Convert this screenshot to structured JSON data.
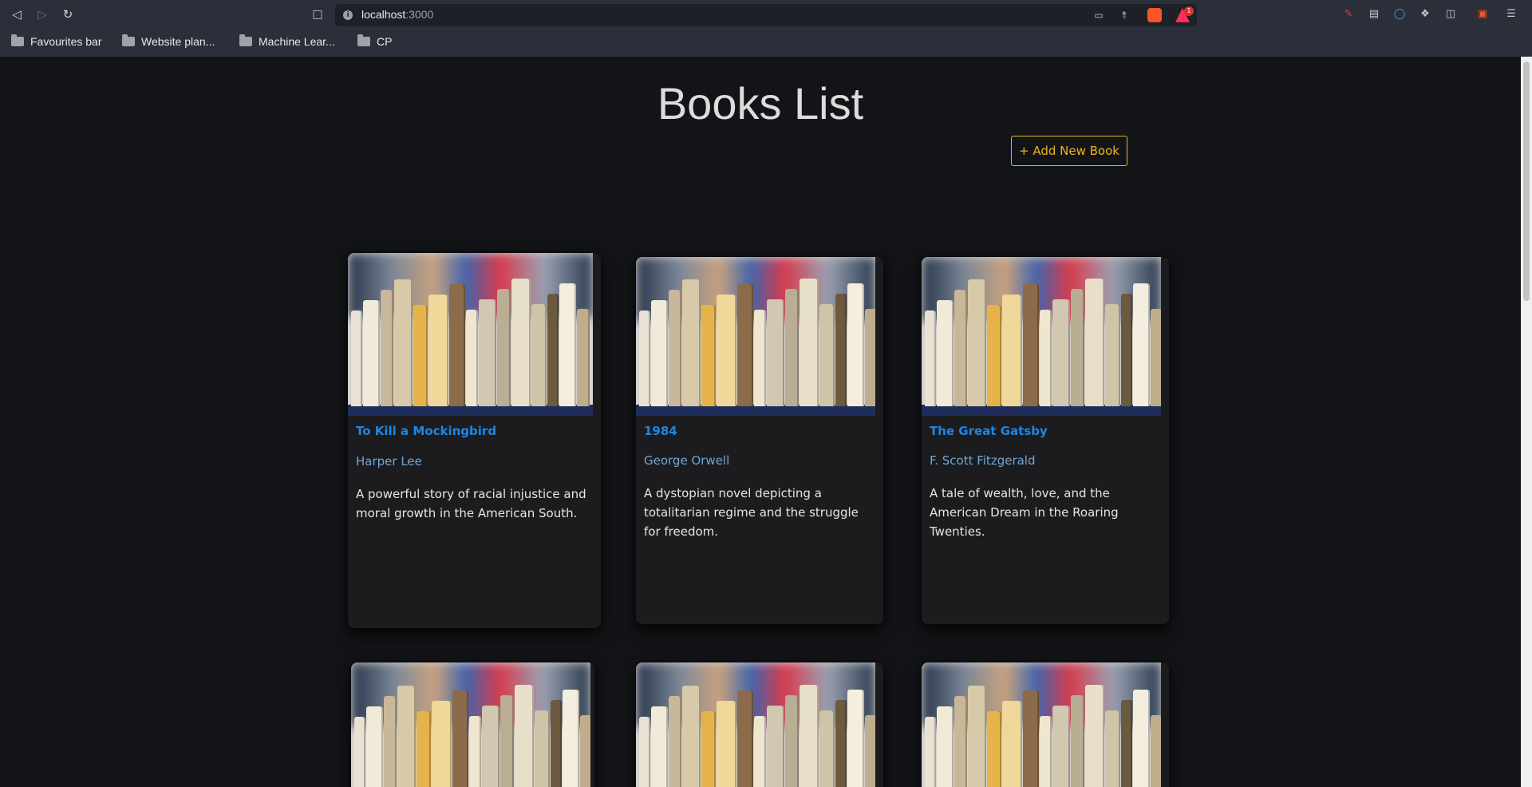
{
  "browser": {
    "url_host": "localhost",
    "url_port": ":3000",
    "notification_count": "1",
    "bookmarks": [
      "Favourites bar",
      "Website plan...",
      "Machine Lear...",
      "CP"
    ]
  },
  "page": {
    "title": "Books List",
    "add_button_label": "+ Add New Book"
  },
  "books": [
    {
      "title": "To Kill a Mockingbird",
      "author": "Harper Lee",
      "description": "A powerful story of racial injustice and moral growth in the American South."
    },
    {
      "title": "1984",
      "author": "George Orwell",
      "description": "A dystopian novel depicting a totalitarian regime and the struggle for freedom."
    },
    {
      "title": "The Great Gatsby",
      "author": "F. Scott Fitzgerald",
      "description": "A tale of wealth, love, and the American Dream in the Roaring Twenties."
    }
  ],
  "colors": {
    "background": "#131417",
    "card": "#1c1c1e",
    "title_link": "#1d86e8",
    "author": "#6fa7d8",
    "accent_button": "#f0b323"
  }
}
